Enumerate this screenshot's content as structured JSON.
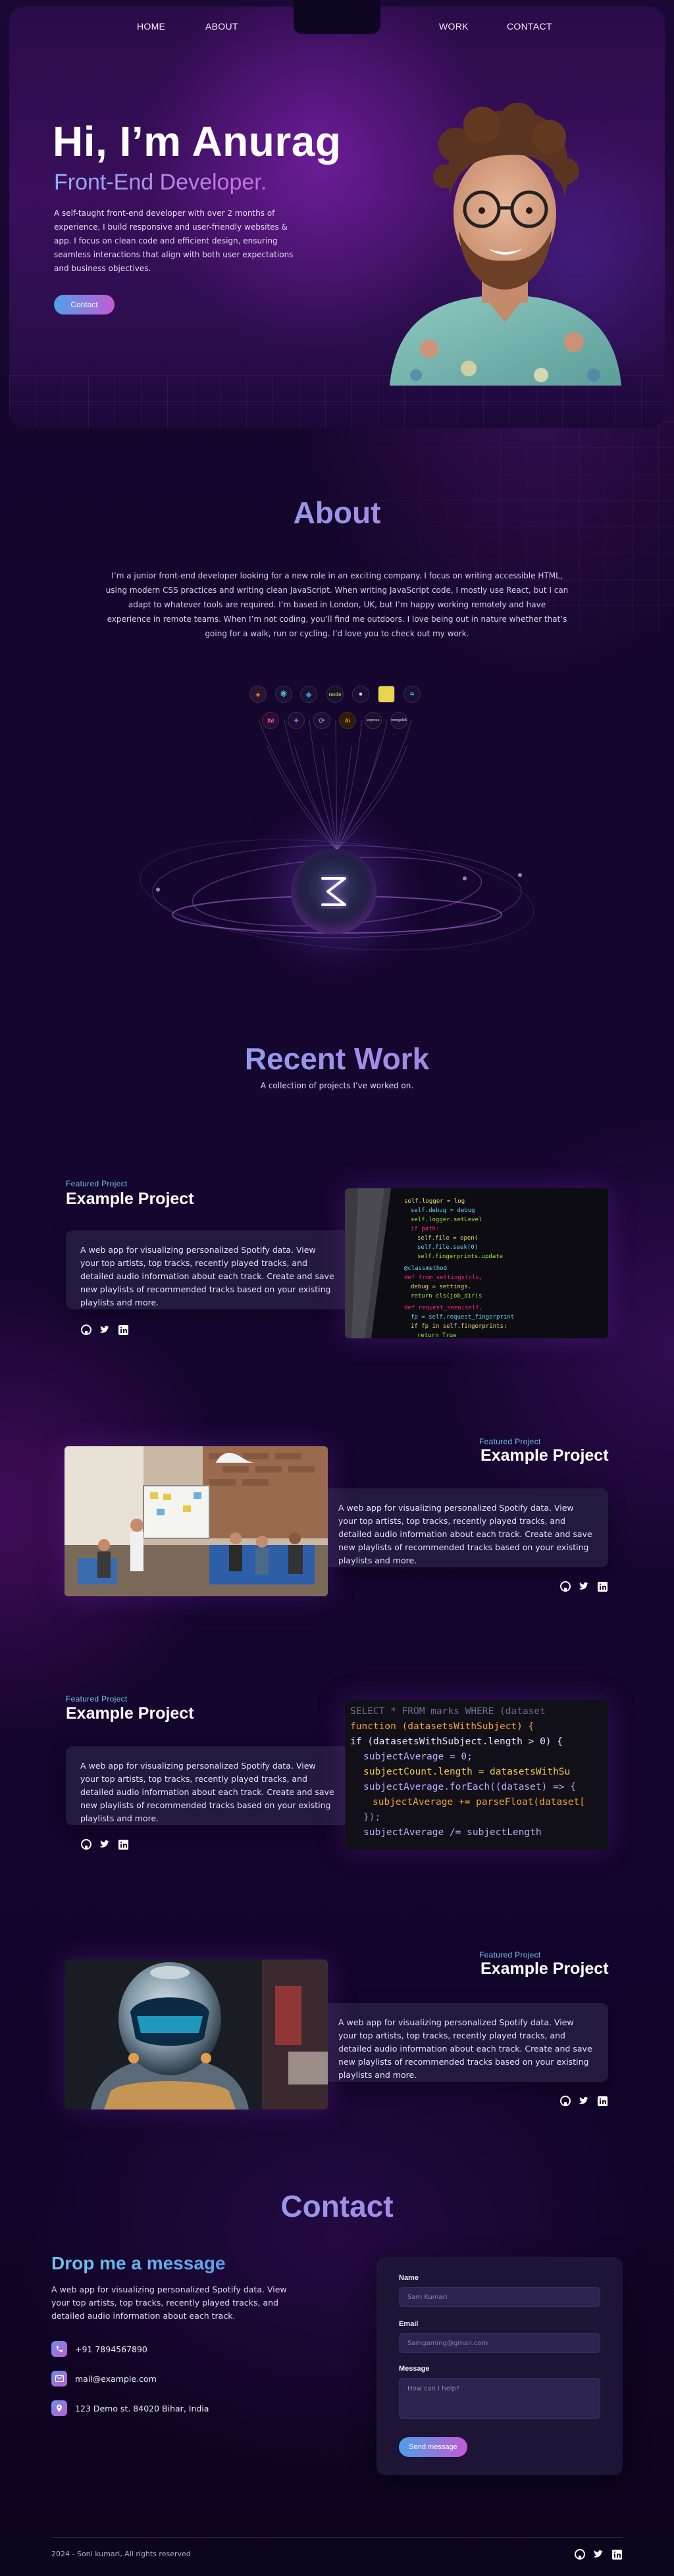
{
  "nav": {
    "links": [
      "HOME",
      "ABOUT",
      "WORK",
      "CONTACT"
    ]
  },
  "hero": {
    "title": "Hi, I’m Anurag",
    "subtitle": "Front-End Developer.",
    "description": "A self-taught front-end developer with over 2 months of experience, I build responsive and user-friendly websites & app. I focus on clean code and efficient design, ensuring seamless interactions that align with both user expectations and business objectives.",
    "cta_label": "Contact"
  },
  "about": {
    "title": "About",
    "text": "I’m a junior front-end developer looking for a new role in an exciting company. I focus on writing accessible HTML, using modern CSS practices and writing clean JavaScript. When writing JavaScript code, I mostly use React, but I can adapt to whatever tools are required. I’m based in London, UK, but I’m happy working remotely and have experience in remote teams. When I’m not coding, you’ll find me outdoors. I love being out in nature whether that’s going for a walk, run or cycling. I’d love you to check out my work.",
    "skills_row1": [
      "html-icon",
      "react-icon",
      "css-icon",
      "node-icon",
      "github-icon",
      "js-icon",
      "tailwind-icon"
    ],
    "skills_row2": [
      "adobe-xd-icon",
      "figma-icon",
      "redux-icon",
      "illustrator-icon",
      "express-icon",
      "mongodb-icon"
    ],
    "skill_labels": {
      "node": "node",
      "ai": "Ai",
      "xd": "Xd",
      "express": "express",
      "mongo": "mongoDB"
    }
  },
  "work": {
    "title": "Recent Work",
    "subtitle": "A collection of projects I’ve worked on.",
    "projects": [
      {
        "label": "Featured  Project",
        "title": "Example Project",
        "description": "A web app for visualizing personalized Spotify data. View your top artists, top tracks, recently played tracks, and detailed audio information about each track. Create and save new playlists of recommended tracks based on your existing playlists and more."
      },
      {
        "label": "Featured  Project",
        "title": "Example Project",
        "description": "A web app for visualizing personalized Spotify data. View your top artists, top tracks, recently played tracks, and detailed audio information about each track. Create and save new playlists of recommended tracks based on your existing playlists and more."
      },
      {
        "label": "Featured  Project",
        "title": "Example Project",
        "description": "A web app for visualizing personalized Spotify data. View your top artists, top tracks, recently played tracks, and detailed audio information about each track. Create and save new playlists of recommended tracks based on your existing playlists and more."
      },
      {
        "label": "Featured  Project",
        "title": "Example Project",
        "description": "A web app for visualizing personalized Spotify data. View your top artists, top tracks, recently played tracks, and detailed audio information about each track. Create and save new playlists of recommended tracks based on your existing playlists and more."
      }
    ],
    "code_snippet": {
      "line1": "SELECT * FROM marks WHERE (dataset",
      "line2": "function (datasetsWithSubject) {",
      "line3": "if (datasetsWithSubject.length > 0) {",
      "line4": "subjectAverage = 0;",
      "line5": "subjectCount.length = datasetsWithSu",
      "line6": "subjectAverage.forEach((dataset) => {",
      "line7": "subjectAverage += parseFloat(dataset[",
      "line8": "});",
      "line9": "subjectAverage /= subjectLength"
    }
  },
  "contact": {
    "title": "Contact",
    "heading": "Drop me a message",
    "description": "A web app for visualizing personalized Spotify data. View your top artists, top tracks, recently played tracks, and detailed audio information about each track.",
    "phone": "+91 7894567890",
    "email": "mail@example.com",
    "address": "123 Demo  st. 84020 Bihar, India",
    "form": {
      "name_label": "Name",
      "name_placeholder": "Sam Kumari",
      "email_label": "Email",
      "email_placeholder": "Samgaming@gmail.com",
      "message_label": "Message",
      "message_placeholder": "How can I help?",
      "submit_label": "Send message"
    }
  },
  "footer": {
    "copyright": "2024 - Soni kumari, All rights reserved"
  },
  "colors": {
    "accent_blue": "#74b9f0",
    "accent_purple": "#c46ae0",
    "background": "#0e0520",
    "card": "#231a3d"
  }
}
